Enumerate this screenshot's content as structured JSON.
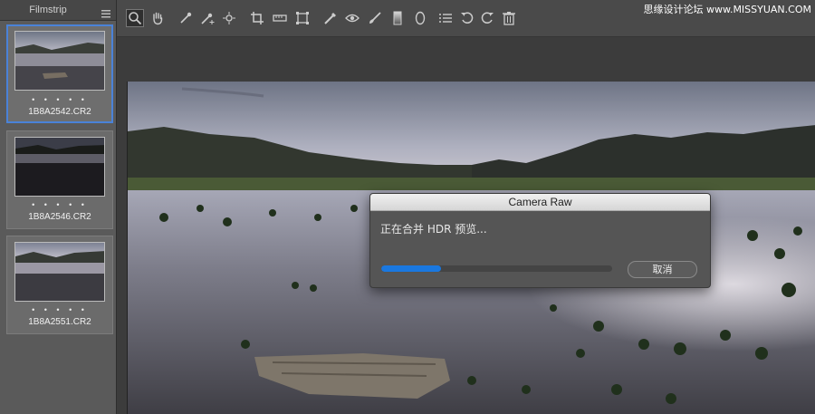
{
  "filmstrip": {
    "title": "Filmstrip",
    "items": [
      {
        "name": "1B8A2542.CR2",
        "rating": "• • • • •",
        "selected": true
      },
      {
        "name": "1B8A2546.CR2",
        "rating": "• • • • •",
        "selected": false
      },
      {
        "name": "1B8A2551.CR2",
        "rating": "• • • • •",
        "selected": false
      }
    ]
  },
  "toolbar": {
    "tools": [
      "zoom-icon",
      "hand-icon",
      "white-balance-icon",
      "color-sampler-icon",
      "targeted-adjustment-icon",
      "crop-icon",
      "straighten-icon",
      "transform-icon",
      "spot-removal-icon",
      "red-eye-icon",
      "adjustment-brush-icon",
      "graduated-filter-icon",
      "radial-filter-icon",
      "preferences-icon",
      "rotate-left-icon",
      "rotate-right-icon",
      "trash-icon"
    ],
    "active_tool": "zoom-icon"
  },
  "watermark": "思缘设计论坛 www.MISSYUAN.COM",
  "dialog": {
    "title": "Camera Raw",
    "message": "正在合并 HDR 预览...",
    "progress": 0.26,
    "cancel_label": "取消"
  },
  "colors": {
    "accent": "#1a78e0",
    "selection": "#4a82d8"
  }
}
